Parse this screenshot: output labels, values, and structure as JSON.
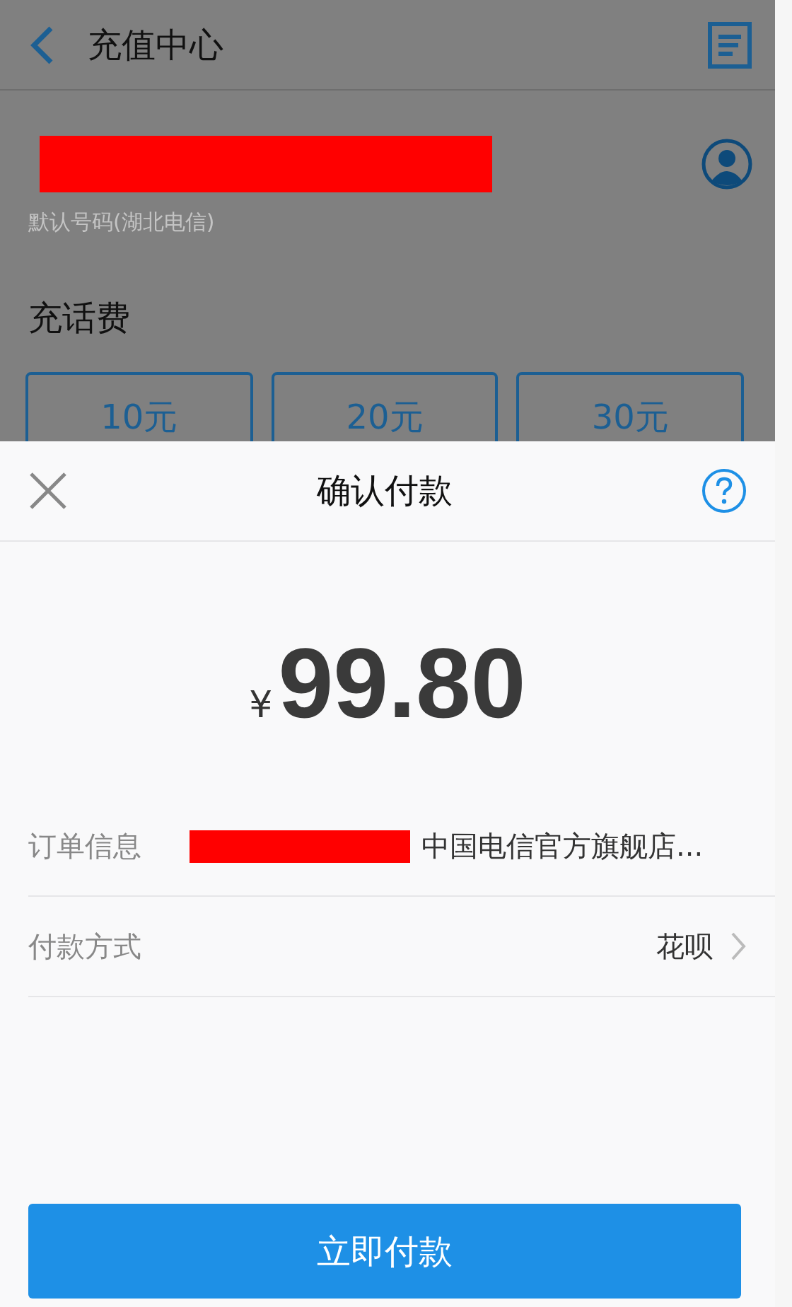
{
  "page": {
    "title": "充值中心",
    "account": {
      "redacted": true,
      "hint": "默认号码(湖北电信)"
    },
    "section_title": "充话费",
    "amounts": [
      {
        "label": "10元"
      },
      {
        "label": "20元"
      },
      {
        "label": "30元"
      }
    ]
  },
  "sheet": {
    "title": "确认付款",
    "currency": "¥",
    "amount": "99.80",
    "rows": [
      {
        "kind": "info",
        "label": "订单信息",
        "redacted": true,
        "value": "中国电信官方旗舰店..."
      },
      {
        "kind": "link",
        "label": "付款方式",
        "value": "花呗"
      }
    ],
    "button": "立即付款"
  }
}
